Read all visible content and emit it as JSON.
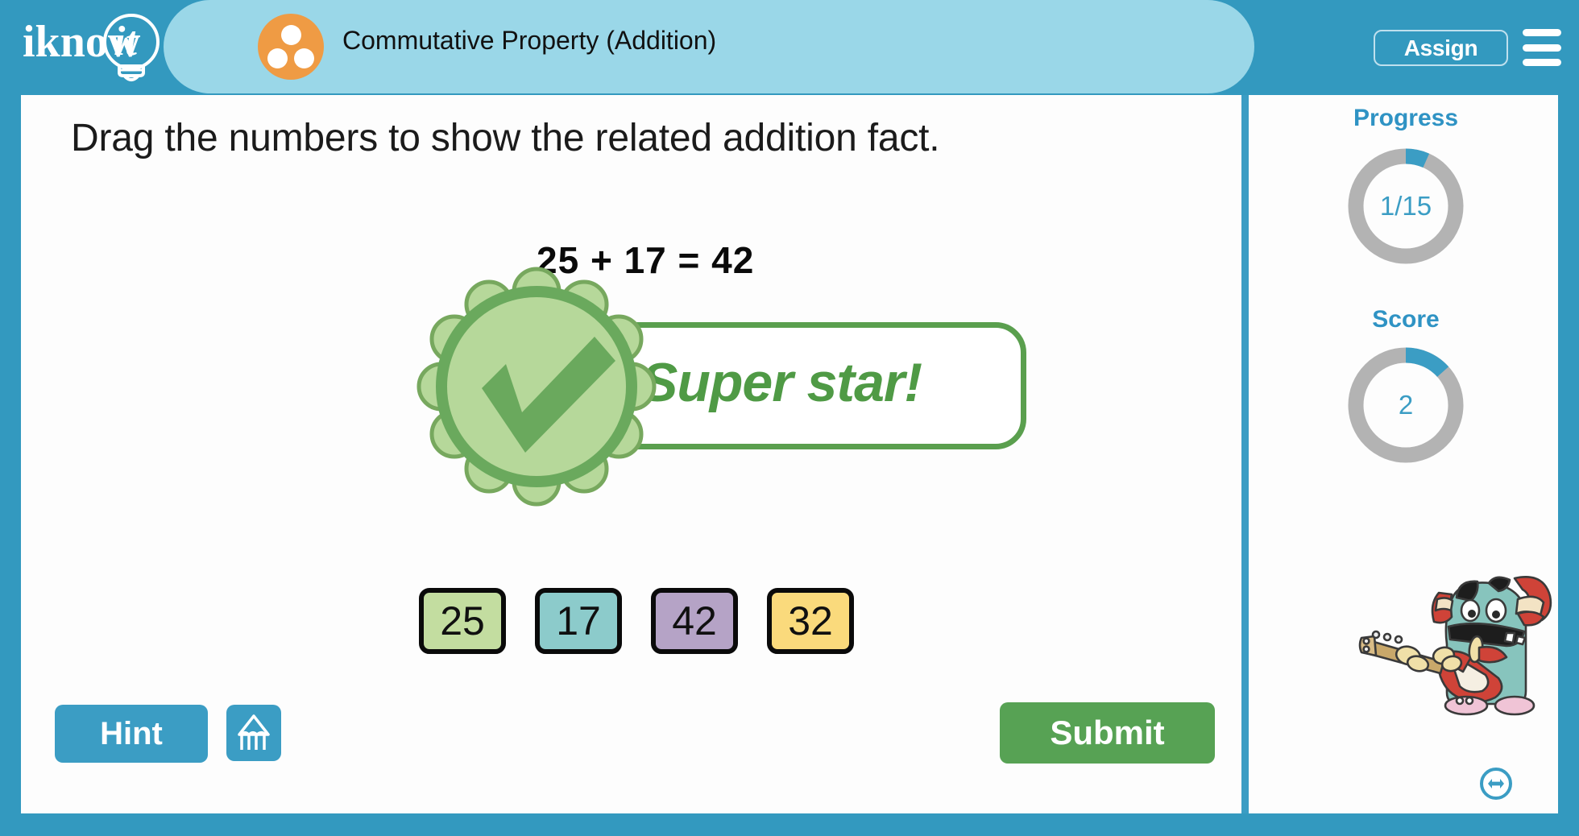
{
  "app": {
    "logo_text": "iknowit",
    "brand_blue": "#3399bf",
    "tab_blue": "#9ad7e8",
    "accent_orange": "#ef9b44",
    "green": "#57a254"
  },
  "header": {
    "topic_title": "Commutative Property (Addition)",
    "topic_icon": "three-dots-circle-icon",
    "assign_label": "Assign",
    "menu_icon": "hamburger-menu-icon"
  },
  "main": {
    "instruction": "Drag the numbers to show the related addition fact.",
    "equation": "25 + 17 = 42",
    "feedback": {
      "text": "Super star!",
      "badge_icon": "green-checkmark-rosette-icon",
      "correct": true
    },
    "tiles": [
      {
        "value": "25",
        "color": "#c3dda0",
        "name": "tile-25"
      },
      {
        "value": "17",
        "color": "#8ccbcb",
        "name": "tile-17"
      },
      {
        "value": "42",
        "color": "#b5a3c6",
        "name": "tile-42"
      },
      {
        "value": "32",
        "color": "#fada7c",
        "name": "tile-32"
      }
    ]
  },
  "toolbar": {
    "hint_label": "Hint",
    "scratchpad_icon": "pencil-scratchpad-icon",
    "submit_label": "Submit"
  },
  "sidebar": {
    "progress": {
      "label": "Progress",
      "value": "1/15",
      "current": 1,
      "total": 15,
      "percent": 6.7
    },
    "score": {
      "label": "Score",
      "value": "2",
      "percent": 13.3
    },
    "mascot_icon": "monster-guitar-mascot",
    "resize_icon": "resize-horizontal-icon"
  }
}
